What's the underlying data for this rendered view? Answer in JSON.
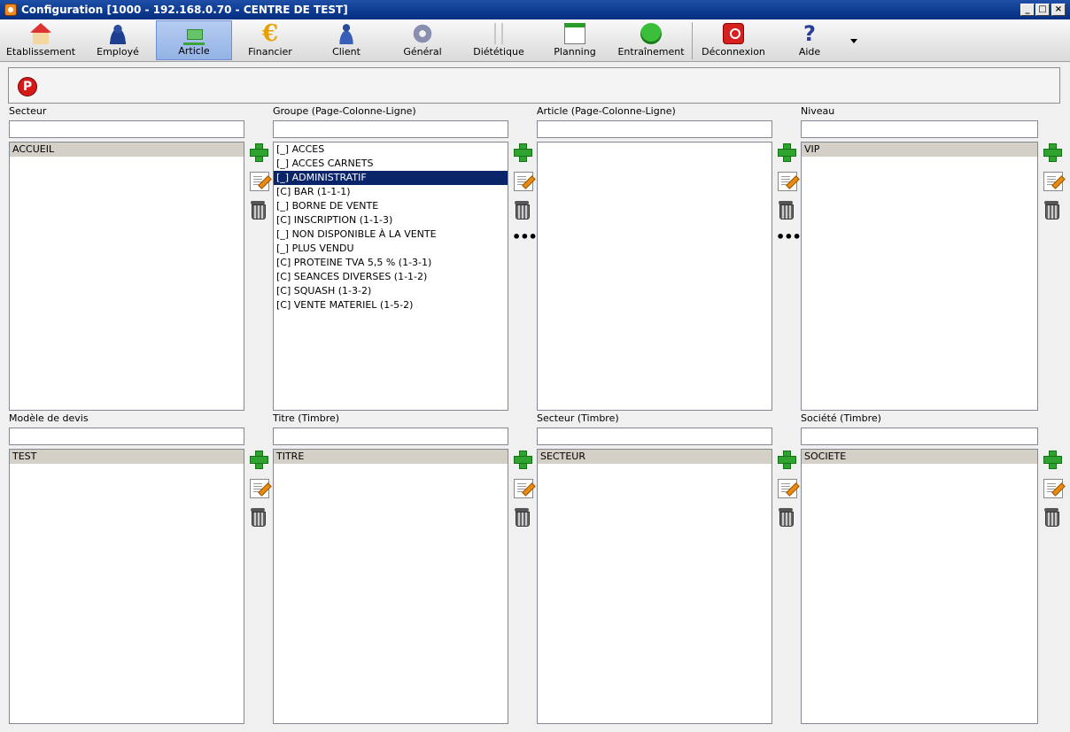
{
  "window": {
    "title": "Configuration [1000 - 192.168.0.70 - CENTRE DE TEST]"
  },
  "toolbar": {
    "items": [
      {
        "label": "Etablissement",
        "icon": "house-icon"
      },
      {
        "label": "Employé",
        "icon": "employee-icon"
      },
      {
        "label": "Article",
        "icon": "cart-icon",
        "active": true
      },
      {
        "label": "Financier",
        "icon": "euro-icon"
      },
      {
        "label": "Client",
        "icon": "client-icon"
      },
      {
        "label": "Général",
        "icon": "gear-icon"
      },
      {
        "label": "Diététique",
        "icon": "cutlery-icon"
      },
      {
        "label": "Planning",
        "icon": "calendar-icon"
      },
      {
        "label": "Entraînement",
        "icon": "runner-icon"
      },
      {
        "label": "Déconnexion",
        "icon": "power-icon"
      },
      {
        "label": "Aide",
        "icon": "help-icon"
      }
    ]
  },
  "subtoolbar": {
    "p_glyph": "P"
  },
  "panels": {
    "secteur": {
      "label": "Secteur",
      "items": [
        "ACCUEIL"
      ]
    },
    "groupe": {
      "label": "Groupe (Page-Colonne-Ligne)",
      "items": [
        "[_] ACCES",
        "[_] ACCES CARNETS",
        "[_] ADMINISTRATIF",
        "[C] BAR (1-1-1)",
        "[_] BORNE DE VENTE",
        "[C] INSCRIPTION (1-1-3)",
        "[_] NON DISPONIBLE À LA VENTE",
        "[_] PLUS VENDU",
        "[C] PROTEINE TVA 5,5 % (1-3-1)",
        "[C] SEANCES DIVERSES (1-1-2)",
        "[C] SQUASH (1-3-2)",
        "[C] VENTE MATERIEL (1-5-2)"
      ],
      "selected_index": 2
    },
    "article": {
      "label": "Article (Page-Colonne-Ligne)",
      "items": []
    },
    "niveau": {
      "label": "Niveau",
      "items": [
        "VIP"
      ]
    },
    "modele_devis": {
      "label": "Modèle de devis",
      "items": [
        "TEST"
      ]
    },
    "titre_timbre": {
      "label": "Titre (Timbre)",
      "items": [
        "TITRE"
      ]
    },
    "secteur_timbre": {
      "label": "Secteur (Timbre)",
      "items": [
        "SECTEUR"
      ]
    },
    "societe_timbre": {
      "label": "Société (Timbre)",
      "items": [
        "SOCIETE"
      ]
    }
  },
  "actions": {
    "more_glyph": "•••"
  },
  "colors": {
    "titlebar": "#0b3a8f",
    "selection_blue": "#0a246a",
    "selection_grey": "#d4d0c8",
    "add_green": "#2fa32f"
  }
}
